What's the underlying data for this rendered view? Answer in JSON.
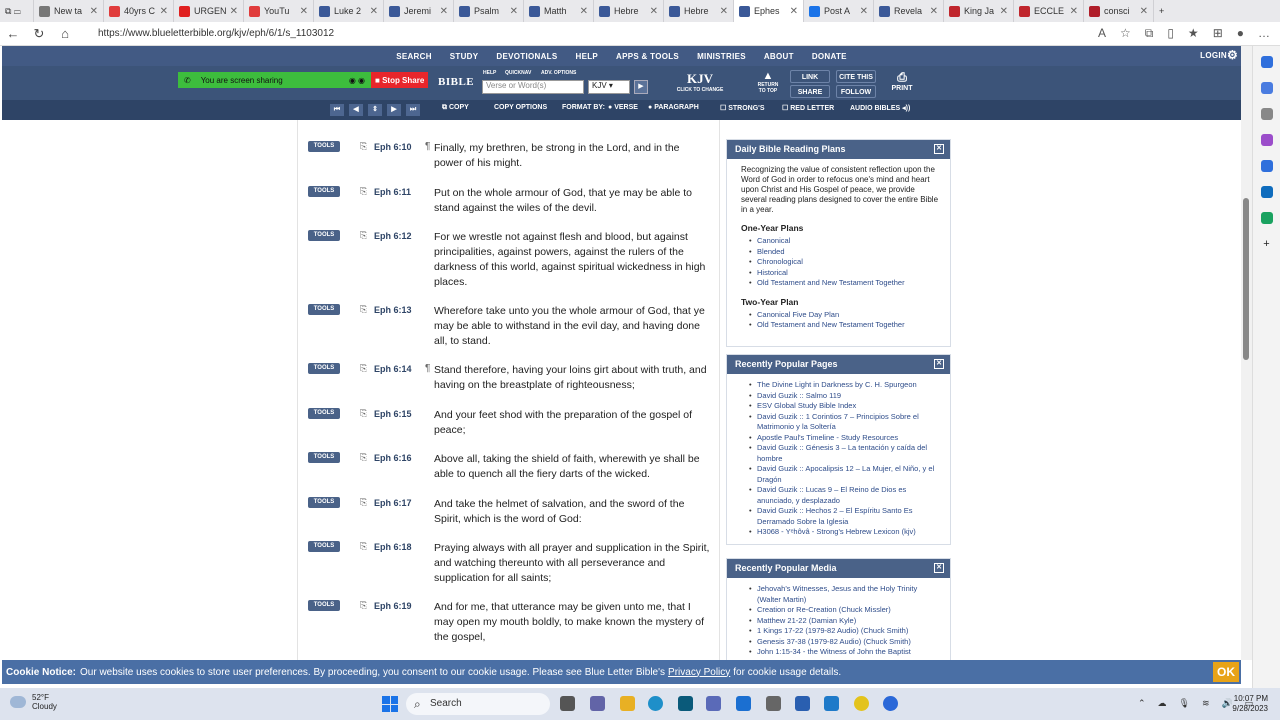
{
  "browser": {
    "tabs": [
      {
        "label": "",
        "color": "#555555"
      },
      {
        "label": "New ta",
        "color": "#777777"
      },
      {
        "label": "40yrs C",
        "color": "#e03c3c"
      },
      {
        "label": "URGEN",
        "color": "#e02020"
      },
      {
        "label": "YouTu",
        "color": "#e03c3c"
      },
      {
        "label": "Luke 2",
        "color": "#3b5998"
      },
      {
        "label": "Jeremi",
        "color": "#3b5998"
      },
      {
        "label": "Psalm",
        "color": "#3b5998"
      },
      {
        "label": "Matth",
        "color": "#3b5998"
      },
      {
        "label": "Hebre",
        "color": "#3b5998"
      },
      {
        "label": "Hebre",
        "color": "#3b5998"
      },
      {
        "label": "Ephes",
        "color": "#3b5998",
        "active": true
      },
      {
        "label": "Post A",
        "color": "#1a73e8"
      },
      {
        "label": "Revela",
        "color": "#3b5998"
      },
      {
        "label": "King Ja",
        "color": "#c0262d"
      },
      {
        "label": "ECCLE",
        "color": "#c0262d"
      },
      {
        "label": "consci",
        "color": "#b01e2a"
      }
    ],
    "url": "https://www.blueletterbible.org/kjv/eph/6/1/s_1103012"
  },
  "site": {
    "nav": [
      "SEARCH",
      "STUDY",
      "DEVOTIONALS",
      "HELP",
      "APPS & TOOLS",
      "MINISTRIES",
      "ABOUT",
      "DONATE"
    ],
    "login": "LOGIN",
    "screen_sharing": "You are screen sharing",
    "stop_share": "Stop Share",
    "bible_label": "BIBLE",
    "mini_help": "HELP",
    "mini_quicknav": "QUICKNAV",
    "mini_adv": "ADV. OPTIONS",
    "verse_placeholder": "Verse or Word(s)",
    "version_select": "KJV",
    "version_title": "KJV",
    "version_sub": "CLICK TO CHANGE",
    "return_top": "RETURN TO TOP",
    "link": "LINK",
    "share": "SHARE",
    "cite": "CITE THIS",
    "follow": "FOLLOW",
    "print": "PRINT",
    "copy": "COPY",
    "copy_options": "COPY OPTIONS",
    "format_by": "FORMAT BY:",
    "verse": "VERSE",
    "paragraph": "PARAGRAPH",
    "strongs": "STRONG'S",
    "red_letter": "RED LETTER",
    "audio_bibles": "AUDIO BIBLES"
  },
  "verses": [
    {
      "ref": "Eph 6:10",
      "pilcrow": true,
      "text": "Finally, my brethren, be strong in the Lord, and in the power of his might."
    },
    {
      "ref": "Eph 6:11",
      "pilcrow": false,
      "text": "Put on the whole armour of God, that ye may be able to stand against the wiles of the devil."
    },
    {
      "ref": "Eph 6:12",
      "pilcrow": false,
      "text": "For we wrestle not against flesh and blood, but against principalities, against powers, against the rulers of the darkness of this world, against spiritual wickedness in high places."
    },
    {
      "ref": "Eph 6:13",
      "pilcrow": false,
      "text": "Wherefore take unto you the whole armour of God, that ye may be able to withstand in the evil day, and having done all, to stand."
    },
    {
      "ref": "Eph 6:14",
      "pilcrow": true,
      "text": "Stand therefore, having your loins girt about with truth, and having on the breastplate of righteousness;"
    },
    {
      "ref": "Eph 6:15",
      "pilcrow": false,
      "text": "And your feet shod with the preparation of the gospel of peace;"
    },
    {
      "ref": "Eph 6:16",
      "pilcrow": false,
      "text": "Above all, taking the shield of faith, wherewith ye shall be able to quench all the fiery darts of the wicked."
    },
    {
      "ref": "Eph 6:17",
      "pilcrow": false,
      "text": "And take the helmet of salvation, and the sword of the Spirit, which is the word of God:"
    },
    {
      "ref": "Eph 6:18",
      "pilcrow": false,
      "text": "Praying always with all prayer and supplication in the Spirit, and watching thereunto with all perseverance and supplication for all saints;"
    },
    {
      "ref": "Eph 6:19",
      "pilcrow": false,
      "text": "And for me, that utterance may be given unto me, that I may open my mouth boldly, to make known the mystery of the gospel,"
    }
  ],
  "tools_label": "TOOLS",
  "reading_plans": {
    "title": "Daily Bible Reading Plans",
    "intro": "Recognizing the value of consistent reflection upon the Word of God in order to refocus one's mind and heart upon Christ and His Gospel of peace, we provide several reading plans designed to cover the entire Bible in a year.",
    "one_year_title": "One-Year Plans",
    "one_year": [
      "Canonical",
      "Blended",
      "Chronological",
      "Historical",
      "Old Testament and New Testament Together"
    ],
    "two_year_title": "Two-Year Plan",
    "two_year": [
      "Canonical Five Day Plan",
      "Old Testament and New Testament Together"
    ]
  },
  "popular_pages": {
    "title": "Recently Popular Pages",
    "items": [
      "The Divine Light in Darkness by C. H. Spurgeon",
      "David Guzik :: Salmo 119",
      "ESV Global Study Bible Index",
      "David Guzik :: 1 Corintios 7 – Principios Sobre el Matrimonio y la Soltería",
      "Apostle Paul's Timeline - Study Resources",
      "David Guzik :: Génesis 3 – La tentación y caída del hombre",
      "David Guzik :: Apocalipsis 12 – La Mujer, el Niño, y el Dragón",
      "David Guzik :: Lucas 9 – El Reino de Dios es anunciado, y desplazado",
      "David Guzik :: Hechos 2 – El Espíritu Santo Es Derramado Sobre la Iglesia",
      "H3068 - Yᵉhôvâ - Strong's Hebrew Lexicon (kjv)"
    ]
  },
  "popular_media": {
    "title": "Recently Popular Media",
    "items": [
      "Jehovah's Witnesses, Jesus and the Holy Trinity (Walter Martin)",
      "Creation or Re-Creation (Chuck Missler)",
      "Matthew 21-22 (Damian Kyle)",
      "1 Kings 17-22 (1979-82 Audio) (Chuck Smith)",
      "Genesis 37-38 (1979-82 Audio) (Chuck Smith)",
      "John 1:15-34 - the Witness of John the Baptist"
    ]
  },
  "cookie": {
    "label": "Cookie Notice:",
    "text": "Our website uses cookies to store user preferences. By proceeding, you consent to our cookie usage. Please see Blue Letter Bible's",
    "link": "Privacy Policy",
    "tail": "for cookie usage details.",
    "ok": "OK"
  },
  "taskbar": {
    "temp": "52°F",
    "weather": "Cloudy",
    "search": "Search",
    "time": "10:07 PM",
    "date": "9/28/2023"
  }
}
